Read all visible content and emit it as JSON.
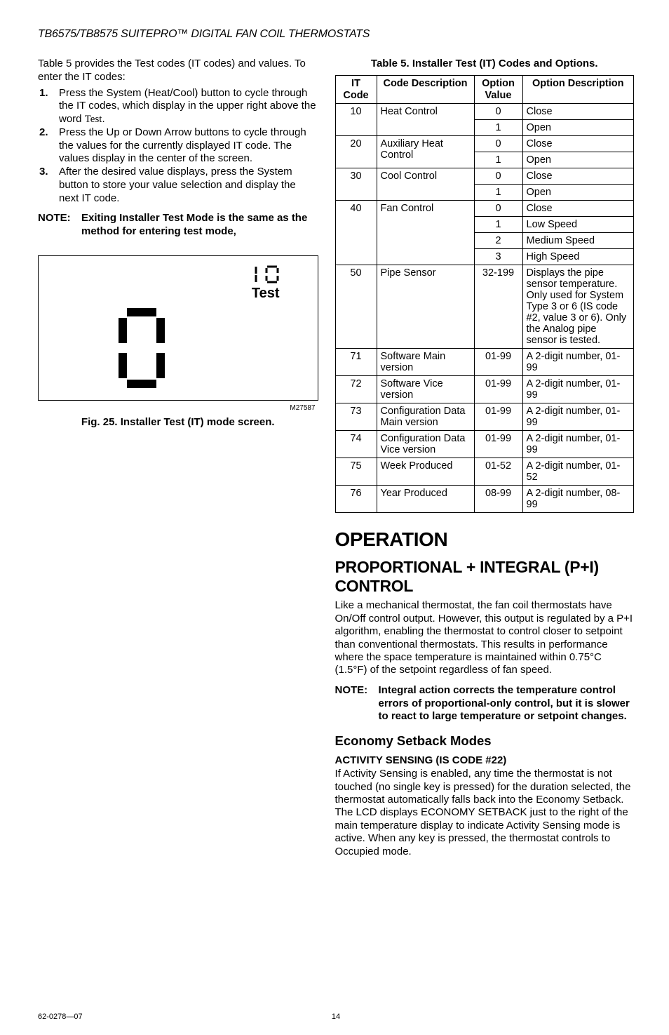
{
  "header": {
    "doc_title": "TB6575/TB8575 SUITEPRO™ DIGITAL FAN COIL THERMOSTATS"
  },
  "intro_para": "Table 5 provides the Test codes (IT codes) and values. To enter the IT codes:",
  "steps": [
    {
      "num": "1.",
      "text_before": "Press the System (Heat/Cool) button to cycle through the IT codes, which display in the upper right above the word ",
      "word_test": "Test",
      "text_after": "."
    },
    {
      "num": "2.",
      "text": "Press the Up or Down Arrow buttons to cycle through the values for the currently displayed IT code. The values display in the center of the screen."
    },
    {
      "num": "3.",
      "text": "After the desired value displays, press the System button to store your value selection and display the next IT code."
    }
  ],
  "note1": {
    "label": "NOTE:",
    "text": "Exiting Installer Test Mode is the same as the method for entering test mode,"
  },
  "figure": {
    "test_label": "Test",
    "code": "M27587",
    "caption": "Fig. 25. Installer Test (IT) mode screen."
  },
  "table": {
    "title": "Table 5. Installer Test (IT) Codes and Options.",
    "headers": {
      "it": "IT Code",
      "desc": "Code Description",
      "val": "Option Value",
      "optdesc": "Option Description"
    },
    "groups": [
      {
        "it": "10",
        "desc": "Heat Control",
        "rows": [
          {
            "val": "0",
            "opt": "Close"
          },
          {
            "val": "1",
            "opt": "Open"
          }
        ]
      },
      {
        "it": "20",
        "desc": "Auxiliary Heat Control",
        "rows": [
          {
            "val": "0",
            "opt": "Close"
          },
          {
            "val": "1",
            "opt": "Open"
          }
        ]
      },
      {
        "it": "30",
        "desc": "Cool Control",
        "rows": [
          {
            "val": "0",
            "opt": "Close"
          },
          {
            "val": "1",
            "opt": "Open"
          }
        ]
      },
      {
        "it": "40",
        "desc": "Fan Control",
        "rows": [
          {
            "val": "0",
            "opt": "Close"
          },
          {
            "val": "1",
            "opt": "Low Speed"
          },
          {
            "val": "2",
            "opt": "Medium Speed"
          },
          {
            "val": "3",
            "opt": "High Speed"
          }
        ]
      },
      {
        "it": "50",
        "desc": "Pipe Sensor",
        "rows": [
          {
            "val": "32-199",
            "opt": "Displays the pipe sensor temperature. Only used for System Type 3 or 6 (IS code #2, value 3 or 6). Only the Analog pipe sensor is tested."
          }
        ]
      },
      {
        "it": "71",
        "desc": "Software Main version",
        "rows": [
          {
            "val": "01-99",
            "opt": "A 2-digit number, 01-99"
          }
        ]
      },
      {
        "it": "72",
        "desc": "Software Vice version",
        "rows": [
          {
            "val": "01-99",
            "opt": "A 2-digit number, 01-99"
          }
        ]
      },
      {
        "it": "73",
        "desc": "Configuration Data Main version",
        "rows": [
          {
            "val": "01-99",
            "opt": "A 2-digit number, 01-99"
          }
        ]
      },
      {
        "it": "74",
        "desc": "Configuration Data Vice version",
        "rows": [
          {
            "val": "01-99",
            "opt": "A 2-digit number, 01-99"
          }
        ]
      },
      {
        "it": "75",
        "desc": "Week Produced",
        "rows": [
          {
            "val": "01-52",
            "opt": "A 2-digit number, 01-52"
          }
        ]
      },
      {
        "it": "76",
        "desc": "Year Produced",
        "rows": [
          {
            "val": "08-99",
            "opt": "A 2-digit number, 08-99"
          }
        ]
      }
    ]
  },
  "operation": {
    "h1": "OPERATION",
    "h2": "PROPORTIONAL + INTEGRAL (P+I) CONTROL",
    "para": "Like a mechanical thermostat, the fan coil thermostats have On/Off control output. However, this output is regulated by a P+I algorithm, enabling the thermostat to control closer to setpoint than conventional thermostats. This results in performance where the space temperature is maintained within 0.75°C (1.5°F) of the setpoint regardless of fan speed.",
    "note_label": "NOTE:",
    "note_text": "Integral action corrects the temperature control errors of proportional-only control, but it is slower to react to large temperature or setpoint changes.",
    "h3": "Economy Setback Modes",
    "h4": "ACTIVITY SENSING (IS CODE #22)",
    "para2": "If Activity Sensing is enabled, any time the thermostat is not touched (no single key is pressed) for the duration selected, the thermostat automatically falls back into the Economy Setback.  The LCD displays ECONOMY SETBACK just to the right of the main temperature display to indicate Activity Sensing mode is active. When any key is pressed, the thermostat controls to Occupied mode."
  },
  "footer": {
    "left": "62-0278—07",
    "center": "14"
  }
}
